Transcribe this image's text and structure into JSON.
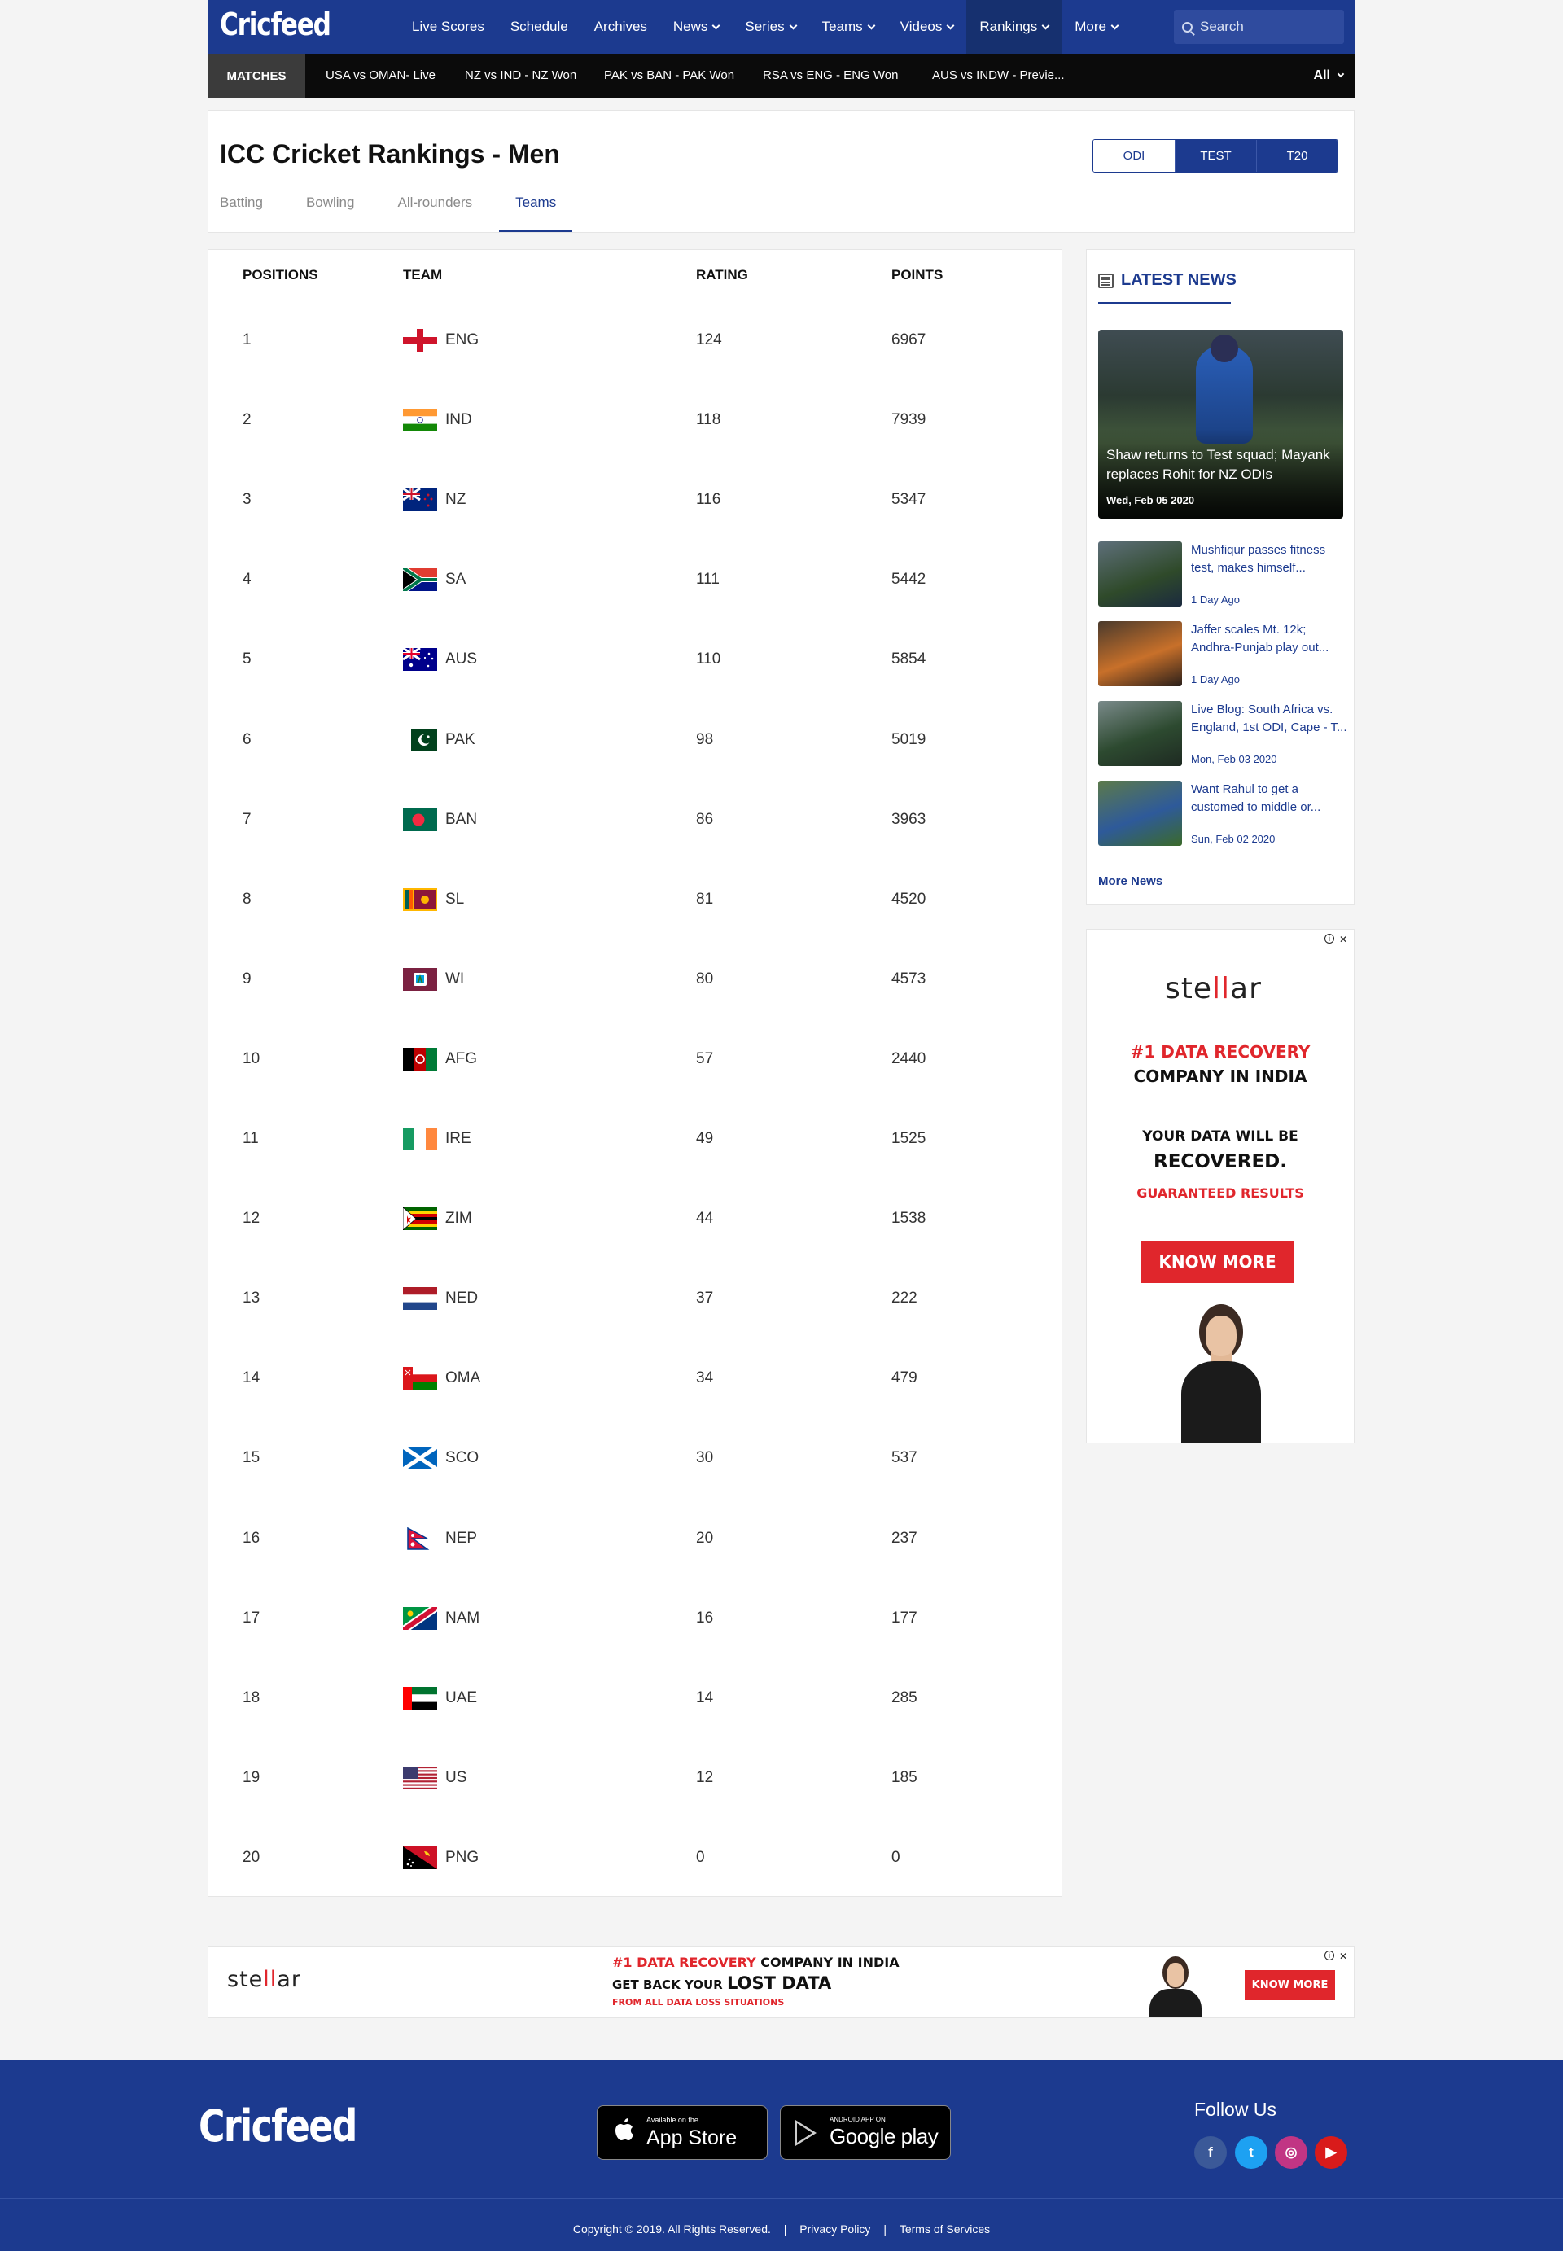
{
  "header": {
    "logo": "Cricfeed",
    "nav": [
      {
        "label": "Live Scores",
        "dropdown": false,
        "active": false
      },
      {
        "label": "Schedule",
        "dropdown": false,
        "active": false
      },
      {
        "label": "Archives",
        "dropdown": false,
        "active": false
      },
      {
        "label": "News",
        "dropdown": true,
        "active": false
      },
      {
        "label": "Series",
        "dropdown": true,
        "active": false
      },
      {
        "label": "Teams",
        "dropdown": true,
        "active": false
      },
      {
        "label": "Videos",
        "dropdown": true,
        "active": false
      },
      {
        "label": "Rankings",
        "dropdown": true,
        "active": true
      },
      {
        "label": "More",
        "dropdown": true,
        "active": false
      }
    ],
    "search_placeholder": "Search"
  },
  "matchbar": {
    "label": "MATCHES",
    "matches": [
      "USA vs OMAN- Live",
      "NZ vs IND - NZ Won",
      "PAK vs BAN - PAK Won",
      "RSA vs  ENG - ENG Won",
      "AUS vs INDW - Previe..."
    ],
    "filter": "All"
  },
  "rankings": {
    "title": "ICC Cricket Rankings - Men",
    "formats": [
      "ODI",
      "TEST",
      "T20"
    ],
    "selected_format": "ODI",
    "tabs": [
      "Batting",
      "Bowling",
      "All-rounders",
      "Teams"
    ],
    "active_tab": "Teams",
    "columns": [
      "POSITIONS",
      "TEAM",
      "RATING",
      "POINTS"
    ],
    "rows": [
      {
        "pos": "1",
        "team": "ENG",
        "flag": "eng",
        "rating": "124",
        "points": "6967"
      },
      {
        "pos": "2",
        "team": "IND",
        "flag": "ind",
        "rating": "118",
        "points": "7939"
      },
      {
        "pos": "3",
        "team": "NZ",
        "flag": "nz",
        "rating": "116",
        "points": "5347"
      },
      {
        "pos": "4",
        "team": "SA",
        "flag": "sa",
        "rating": "111",
        "points": "5442"
      },
      {
        "pos": "5",
        "team": "AUS",
        "flag": "aus",
        "rating": "110",
        "points": "5854"
      },
      {
        "pos": "6",
        "team": "PAK",
        "flag": "pak",
        "rating": "98",
        "points": "5019"
      },
      {
        "pos": "7",
        "team": "BAN",
        "flag": "ban",
        "rating": "86",
        "points": "3963"
      },
      {
        "pos": "8",
        "team": "SL",
        "flag": "sl",
        "rating": "81",
        "points": "4520"
      },
      {
        "pos": "9",
        "team": "WI",
        "flag": "wi",
        "rating": "80",
        "points": "4573"
      },
      {
        "pos": "10",
        "team": "AFG",
        "flag": "afg",
        "rating": "57",
        "points": "2440"
      },
      {
        "pos": "11",
        "team": "IRE",
        "flag": "ire",
        "rating": "49",
        "points": "1525"
      },
      {
        "pos": "12",
        "team": "ZIM",
        "flag": "zim",
        "rating": "44",
        "points": "1538"
      },
      {
        "pos": "13",
        "team": "NED",
        "flag": "ned",
        "rating": "37",
        "points": "222"
      },
      {
        "pos": "14",
        "team": "OMA",
        "flag": "oma",
        "rating": "34",
        "points": "479"
      },
      {
        "pos": "15",
        "team": "SCO",
        "flag": "sco",
        "rating": "30",
        "points": "537"
      },
      {
        "pos": "16",
        "team": "NEP",
        "flag": "nep",
        "rating": "20",
        "points": "237"
      },
      {
        "pos": "17",
        "team": "NAM",
        "flag": "nam",
        "rating": "16",
        "points": "177"
      },
      {
        "pos": "18",
        "team": "UAE",
        "flag": "uae",
        "rating": "14",
        "points": "285"
      },
      {
        "pos": "19",
        "team": "US",
        "flag": "usa",
        "rating": "12",
        "points": "185"
      },
      {
        "pos": "20",
        "team": "PNG",
        "flag": "png",
        "rating": "0",
        "points": "0"
      }
    ]
  },
  "news": {
    "heading": "LATEST NEWS",
    "lead": {
      "title": "Shaw returns to Test squad; Mayank replaces Rohit for NZ ODIs",
      "date": "Wed, Feb 05 2020"
    },
    "items": [
      {
        "title": "Mushfiqur passes fitness test, makes himself...",
        "date": "1 Day Ago"
      },
      {
        "title": "Jaffer scales Mt. 12k; Andhra-Punjab play out...",
        "date": "1 Day Ago"
      },
      {
        "title": "Live Blog: South Africa vs. England, 1st ODI, Cape - T...",
        "date": "Mon, Feb 03 2020"
      },
      {
        "title": "Want Rahul to get a customed to middle or...",
        "date": "Sun, Feb 02 2020"
      }
    ],
    "more": "More News"
  },
  "ad_side": {
    "brand_a": "ste",
    "brand_b": "ll",
    "brand_c": "ar",
    "line1_red": "#1 DATA RECOVERY",
    "line2": "COMPANY IN INDIA",
    "line3": "YOUR DATA WILL BE",
    "line4": "RECOVERED.",
    "line5": "GUARANTEED RESULTS",
    "button": "KNOW MORE"
  },
  "ad_bottom": {
    "brand_a": "ste",
    "brand_b": "ll",
    "brand_c": "ar",
    "line1_red": "#1 DATA RECOVERY",
    "line1_rest": " COMPANY IN INDIA",
    "line2_a": "GET BACK YOUR ",
    "line2_b": "LOST DATA",
    "line3": "FROM ALL DATA LOSS SITUATIONS",
    "button": "KNOW MORE"
  },
  "ad_controls": {
    "info": "i",
    "close": "✕"
  },
  "footer": {
    "logo": "Cricfeed",
    "appstore_small": "Available on the",
    "appstore_big": "App Store",
    "google_small": "ANDROID APP ON",
    "google_big": "Google play",
    "follow": "Follow Us",
    "social": [
      {
        "name": "facebook",
        "glyph": "f",
        "color": "#3b5998"
      },
      {
        "name": "twitter",
        "glyph": "t",
        "color": "#1da1f2"
      },
      {
        "name": "instagram",
        "glyph": "◎",
        "color": "#c13584"
      },
      {
        "name": "youtube",
        "glyph": "▶",
        "color": "#d91b1b"
      }
    ],
    "copyright": "Copyright © 2019. All Rights Reserved.",
    "privacy": "Privacy Policy",
    "terms": "Terms of Services",
    "sep": "|"
  },
  "colors": {
    "brand": "#1c3a8f",
    "ad_red": "#e0262c",
    "match_bar": "#0b0b0b"
  }
}
